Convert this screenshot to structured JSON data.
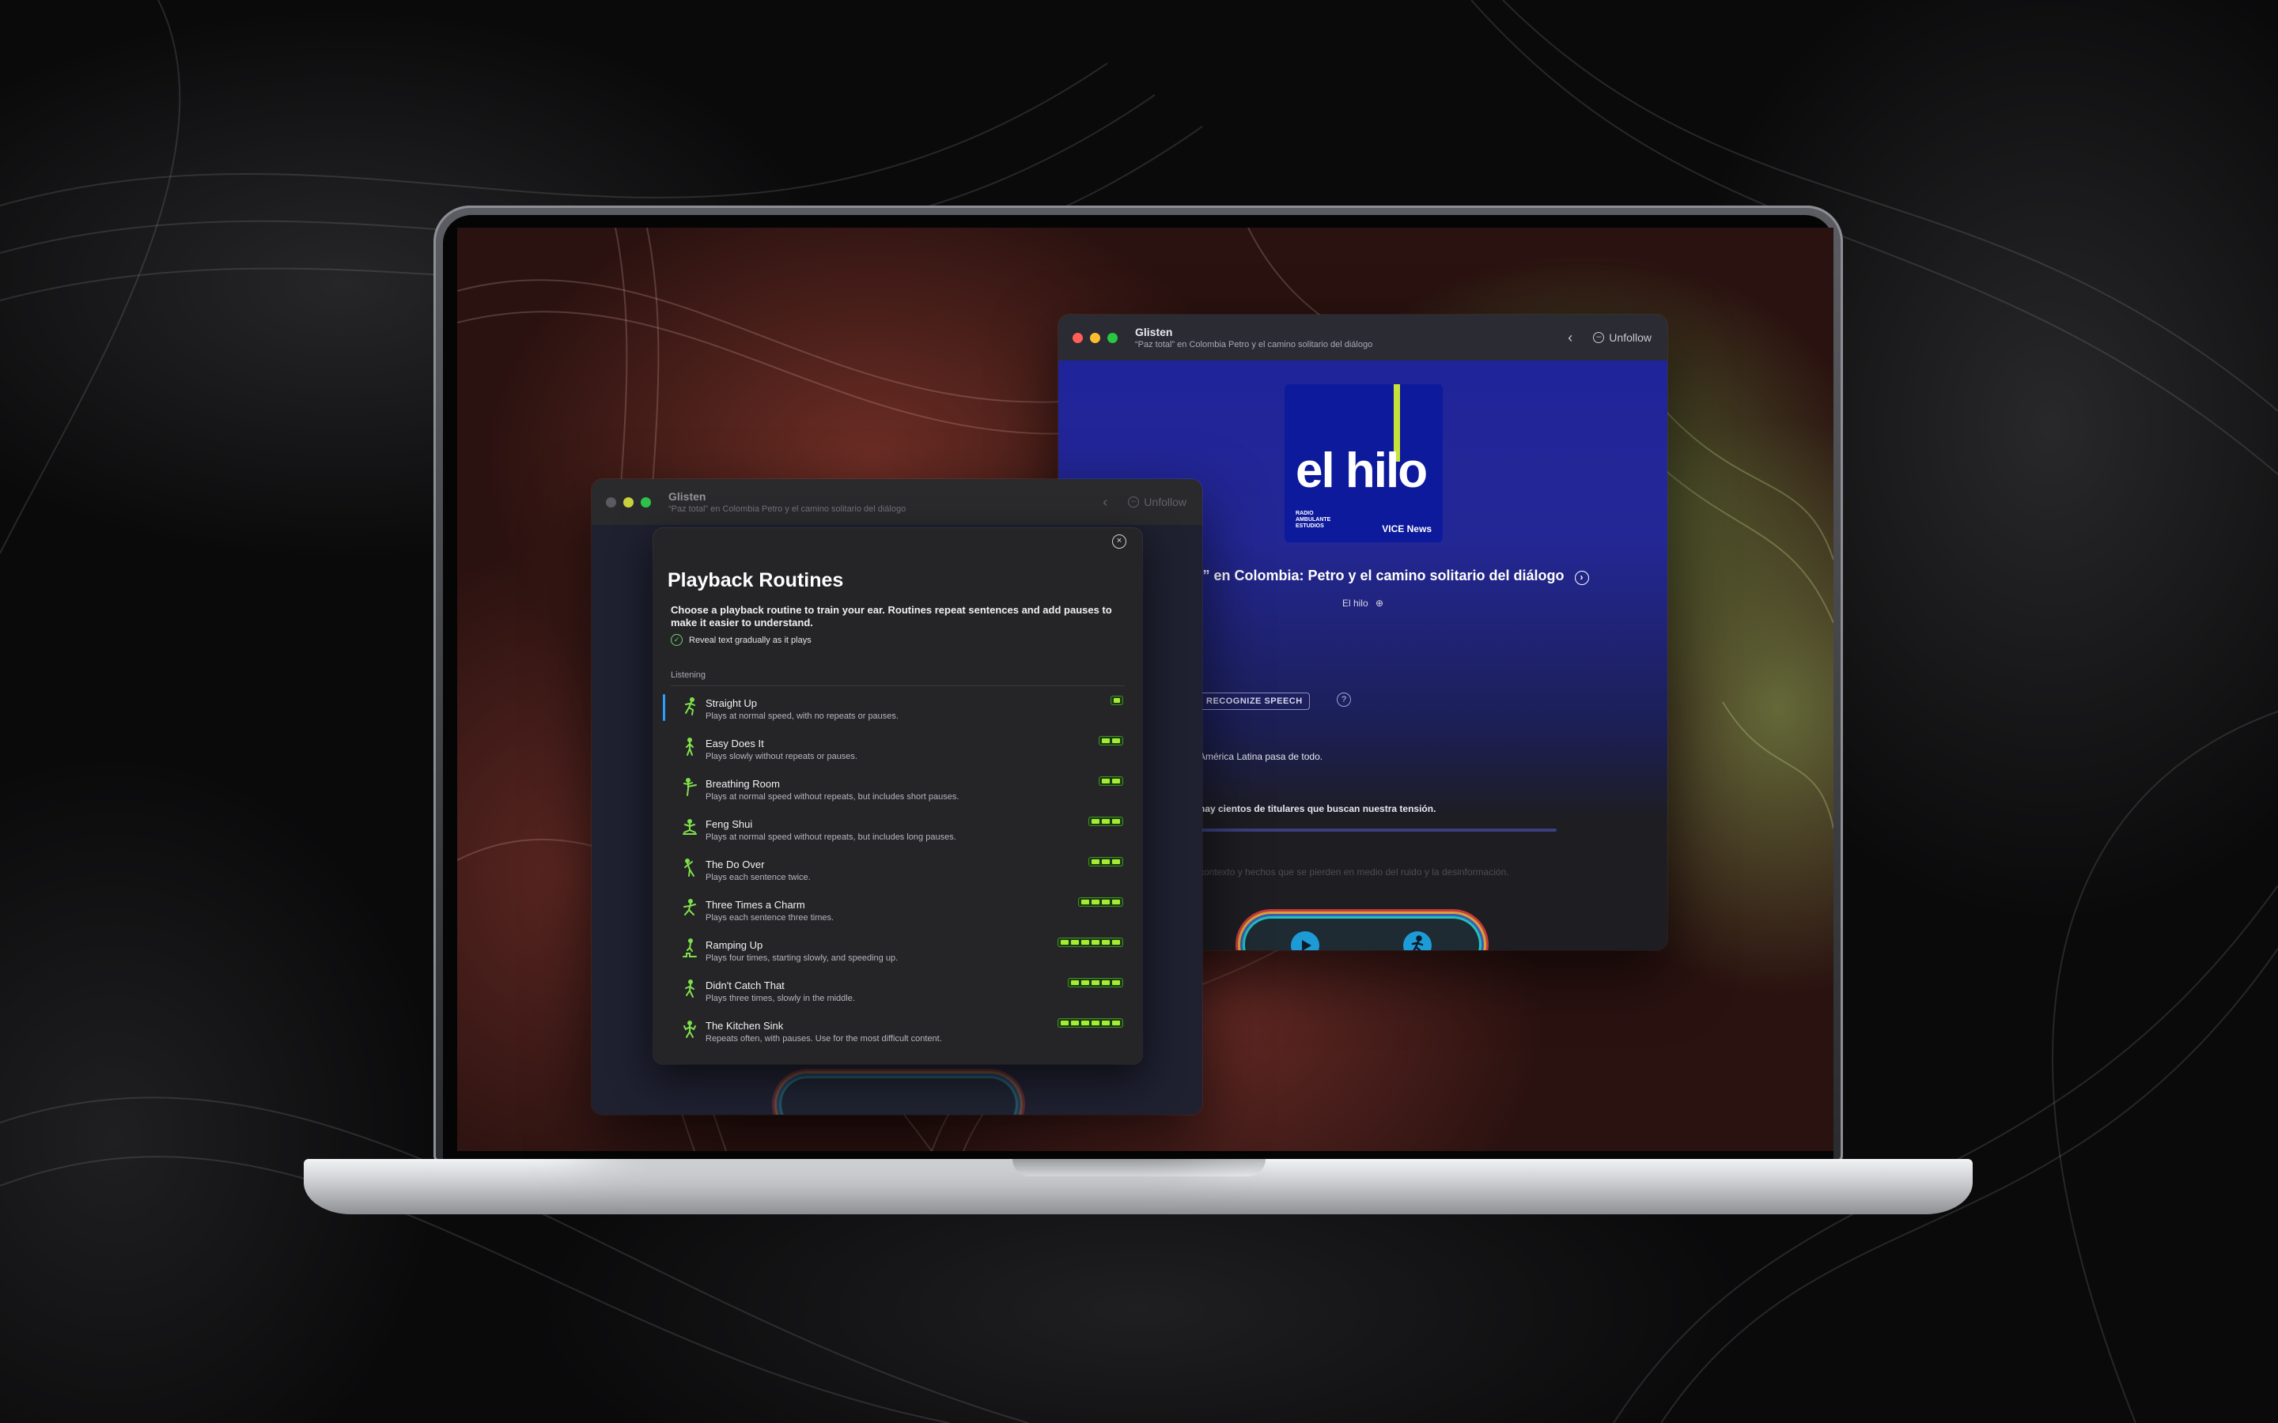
{
  "colors": {
    "accent_green": "#a6ec33",
    "selection_blue": "#2ba0ff",
    "traffic_red": "#ff5f57",
    "traffic_yellow": "#febc2e",
    "traffic_green": "#28c840",
    "podcast_blue": "#0d1a9c"
  },
  "back_window": {
    "title": "Glisten",
    "subtitle": "“Paz total” en Colombia Petro y el camino solitario del diálogo",
    "back_icon": "chevron-left-icon",
    "unfollow_label": "Unfollow",
    "unfollow_icon": "minus-circle-icon",
    "artwork": {
      "show_logo": "el hilo",
      "network_small": "RADIO AMBULANTE ESTUDIOS",
      "network_vice": "VICE News"
    },
    "episode_title": "“Paz total” en Colombia: Petro y el camino solitario del diálogo",
    "show_name": "El hilo",
    "recognize_label": "RECOGNIZE SPEECH",
    "help_icon": "question-icon",
    "line1": "América Latina pasa de todo.",
    "line2": "hay cientos de titulares que buscan nuestra tensión.",
    "line3": "contexto y hechos que se pierden en medio del ruido y la desinformación.",
    "player": {
      "play_icon": "play-icon",
      "routine_icon": "runner-icon"
    }
  },
  "front_window": {
    "title": "Glisten",
    "subtitle": "“Paz total” en Colombia Petro y el camino solitario del diálogo",
    "unfollow_label": "Unfollow"
  },
  "sheet": {
    "close_icon": "close-icon",
    "title": "Playback Routines",
    "description": "Choose a playback routine to train your ear. Routines repeat sentences and add pauses to make it easier to understand.",
    "reveal_label": "Reveal text gradually as it plays",
    "section_label": "Listening",
    "routines": [
      {
        "name": "Straight Up",
        "desc": "Plays at normal speed, with no repeats or pauses.",
        "icon": "runner-fast-icon",
        "level": 1
      },
      {
        "name": "Easy Does It",
        "desc": "Plays slowly without repeats or pauses.",
        "icon": "walker-icon",
        "level": 2
      },
      {
        "name": "Breathing Room",
        "desc": "Plays at normal speed without repeats, but includes short pauses.",
        "icon": "kick-icon",
        "level": 2
      },
      {
        "name": "Feng Shui",
        "desc": "Plays at normal speed without repeats, but includes long pauses.",
        "icon": "meditation-icon",
        "level": 3
      },
      {
        "name": "The Do Over",
        "desc": "Plays each sentence twice.",
        "icon": "climber-icon",
        "level": 3
      },
      {
        "name": "Three Times a Charm",
        "desc": "Plays each sentence three times.",
        "icon": "dancer-icon",
        "level": 4
      },
      {
        "name": "Ramping Up",
        "desc": "Plays four times, starting slowly, and speeding up.",
        "icon": "stairs-icon",
        "level": 6
      },
      {
        "name": "Didn't Catch That",
        "desc": "Plays three times, slowly in the middle.",
        "icon": "jog-icon",
        "level": 5
      },
      {
        "name": "The Kitchen Sink",
        "desc": "Repeats often, with pauses. Use for the most difficult content.",
        "icon": "lifter-icon",
        "level": 6
      }
    ]
  }
}
